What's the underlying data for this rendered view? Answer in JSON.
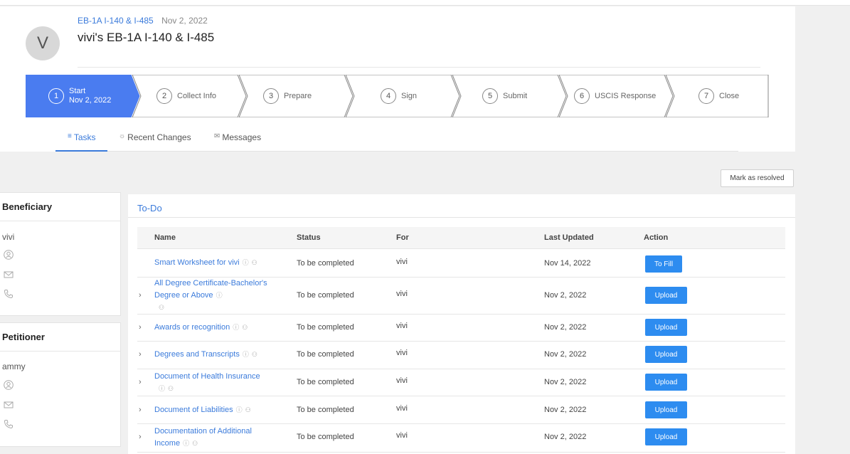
{
  "case": {
    "avatar_letter": "V",
    "breadcrumb_link": "EB-1A I-140 & I-485",
    "breadcrumb_date": "Nov 2, 2022",
    "title": "vivi's EB-1A I-140 & I-485"
  },
  "steps": [
    {
      "num": "1",
      "label": "Start",
      "sub": "Nov 2, 2022",
      "active": true
    },
    {
      "num": "2",
      "label": "Collect Info"
    },
    {
      "num": "3",
      "label": "Prepare"
    },
    {
      "num": "4",
      "label": "Sign"
    },
    {
      "num": "5",
      "label": "Submit"
    },
    {
      "num": "6",
      "label": "USCIS Response"
    },
    {
      "num": "7",
      "label": "Close"
    }
  ],
  "tabs": [
    {
      "icon": "list-icon",
      "glyph": "≡",
      "label": "Tasks",
      "active": true
    },
    {
      "icon": "lightbulb-icon",
      "glyph": "☼",
      "label": "Recent Changes"
    },
    {
      "icon": "chat-icon",
      "glyph": "✉",
      "label": "Messages"
    }
  ],
  "mark_resolved": "Mark as resolved",
  "beneficiary": {
    "heading": "Beneficiary",
    "name": "vivi"
  },
  "petitioner": {
    "heading": "Petitioner",
    "name": "ammy"
  },
  "todo": {
    "title": "To-Do",
    "columns": {
      "name": "Name",
      "status": "Status",
      "for": "For",
      "last_updated": "Last Updated",
      "action": "Action"
    },
    "rows": [
      {
        "name": "Smart Worksheet for vivi",
        "status": "To be completed",
        "for": "vivi",
        "updated": "Nov 14, 2022",
        "action": "To Fill",
        "expandable": false
      },
      {
        "name": "All Degree Certificate-Bachelor's Degree or Above",
        "status": "To be completed",
        "for": "vivi",
        "updated": "Nov 2, 2022",
        "action": "Upload",
        "expandable": true
      },
      {
        "name": "Awards or recognition",
        "status": "To be completed",
        "for": "vivi",
        "updated": "Nov 2, 2022",
        "action": "Upload",
        "expandable": true
      },
      {
        "name": "Degrees and Transcripts",
        "status": "To be completed",
        "for": "vivi",
        "updated": "Nov 2, 2022",
        "action": "Upload",
        "expandable": true
      },
      {
        "name": "Document of Health Insurance",
        "status": "To be completed",
        "for": "vivi",
        "updated": "Nov 2, 2022",
        "action": "Upload",
        "expandable": true
      },
      {
        "name": "Document of Liabilities",
        "status": "To be completed",
        "for": "vivi",
        "updated": "Nov 2, 2022",
        "action": "Upload",
        "expandable": true
      },
      {
        "name": "Documentation of Additional Income",
        "status": "To be completed",
        "for": "vivi",
        "updated": "Nov 2, 2022",
        "action": "Upload",
        "expandable": true
      }
    ]
  },
  "colors": {
    "accent": "#4a7cf0",
    "link": "#3b7bdb",
    "button": "#2d8cf0"
  }
}
